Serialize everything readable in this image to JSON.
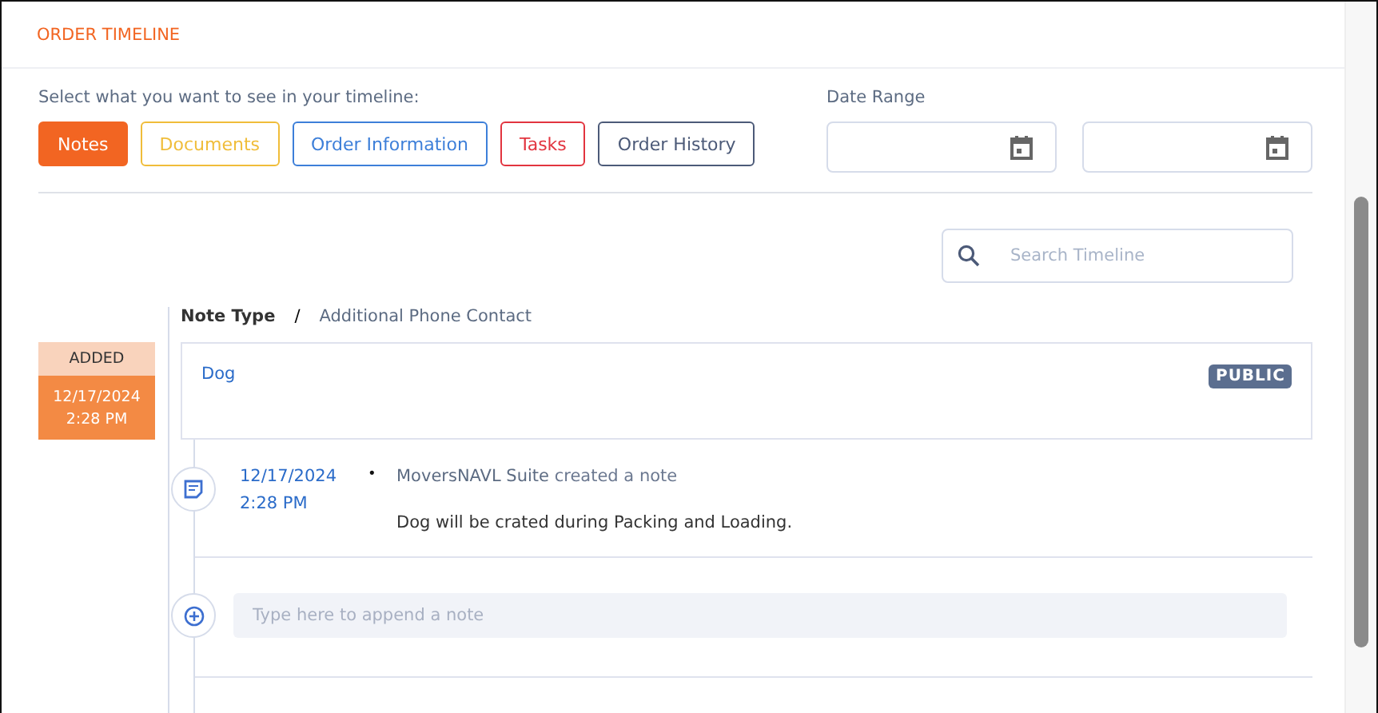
{
  "header": {
    "title": "ORDER TIMELINE"
  },
  "filters": {
    "label": "Select what you want to see in your timeline:",
    "items": [
      {
        "label": "Notes",
        "selected": true,
        "color": "#f26522"
      },
      {
        "label": "Documents",
        "selected": false,
        "color": "#f0bd3a"
      },
      {
        "label": "Order Information",
        "selected": false,
        "color": "#3d7fd9"
      },
      {
        "label": "Tasks",
        "selected": false,
        "color": "#e2343f"
      },
      {
        "label": "Order History",
        "selected": false,
        "color": "#4c5a78"
      }
    ]
  },
  "date_range": {
    "label": "Date Range"
  },
  "search": {
    "placeholder": "Search Timeline"
  },
  "entries": [
    {
      "status": "ADDED",
      "date": "12/17/2024",
      "time": "2:28 PM",
      "type_label": "Note Type",
      "separator": "/",
      "type_value": "Additional Phone Contact",
      "title": "Dog",
      "visibility": "PUBLIC",
      "events": [
        {
          "date": "12/17/2024",
          "time": "2:28 PM",
          "bullet": "•",
          "author": "MoversNAVL Suite",
          "action": "created a note",
          "body": "Dog will be crated during Packing and Loading."
        }
      ],
      "append_placeholder": "Type here to append a note"
    }
  ]
}
